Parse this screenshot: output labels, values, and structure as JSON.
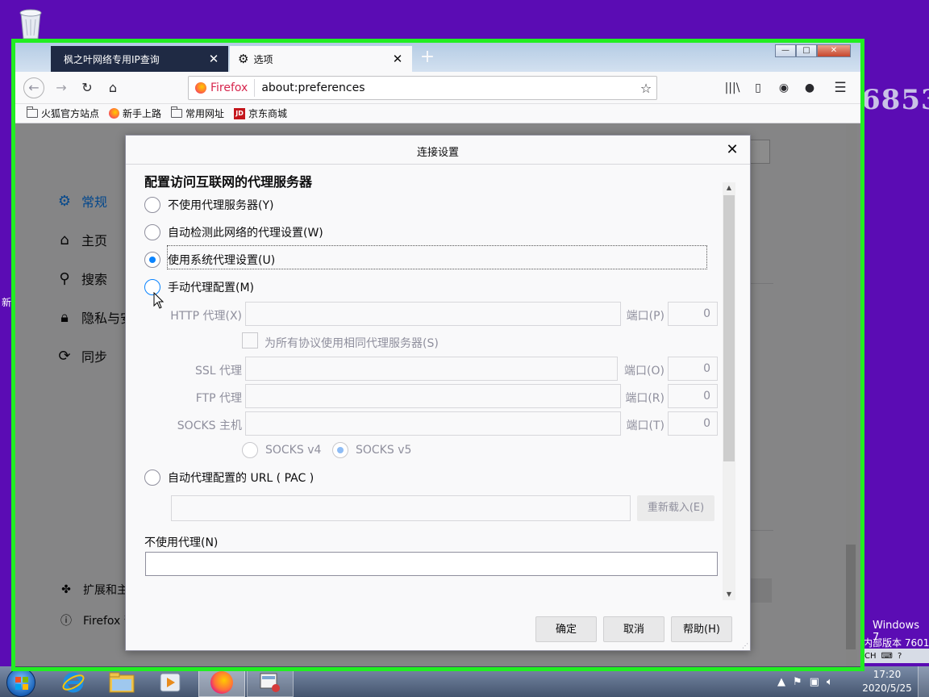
{
  "desktop": {
    "watermark": "6853",
    "side_text": "新",
    "windows_version": "Windows 7",
    "windows_build": "内部版本 7601"
  },
  "browser": {
    "tabs": [
      {
        "label": "枫之叶网络专用IP查询",
        "active": false
      },
      {
        "label": "选项",
        "active": true
      }
    ],
    "window_controls": {
      "minimize": "—",
      "maximize": "□",
      "close": "✕"
    },
    "url": {
      "identity": "Firefox",
      "text": "about:preferences"
    },
    "bookmarks": [
      {
        "label": "火狐官方站点",
        "icon": "folder-icon"
      },
      {
        "label": "新手上路",
        "icon": "firefox-icon"
      },
      {
        "label": "常用网址",
        "icon": "folder-icon"
      },
      {
        "label": "京东商城",
        "icon": "jd-icon"
      }
    ],
    "jd_icon_text": "JD"
  },
  "preferences": {
    "sidebar": [
      {
        "label": "常规",
        "icon": "gear-icon"
      },
      {
        "label": "主页",
        "icon": "home-icon"
      },
      {
        "label": "搜索",
        "icon": "search-icon"
      },
      {
        "label": "隐私与安",
        "icon": "lock-icon"
      },
      {
        "label": "同步",
        "icon": "sync-icon"
      }
    ],
    "extensions_label": "扩展和主",
    "help_label": "Firefox 帮"
  },
  "dialog": {
    "title": "连接设置",
    "heading": "配置访问互联网的代理服务器",
    "options": {
      "none": "不使用代理服务器(Y)",
      "auto_detect": "自动检测此网络的代理设置(W)",
      "system": "使用系统代理设置(U)",
      "manual": "手动代理配置(M)",
      "pac": "自动代理配置的 URL ( PAC )"
    },
    "selected": "system",
    "manual": {
      "http_label": "HTTP 代理(X)",
      "http_port_label": "端口(P)",
      "http_port": "0",
      "share_label": "为所有协议使用相同代理服务器(S)",
      "ssl_label": "SSL 代理",
      "ssl_port_label": "端口(O)",
      "ssl_port": "0",
      "ftp_label": "FTP 代理",
      "ftp_port_label": "端口(R)",
      "ftp_port": "0",
      "socks_label": "SOCKS 主机",
      "socks_port_label": "端口(T)",
      "socks_port": "0",
      "socks_v4": "SOCKS v4",
      "socks_v5": "SOCKS v5",
      "socks_version_selected": "SOCKS v5"
    },
    "reload_label": "重新载入(E)",
    "no_proxy_label": "不使用代理(N)",
    "buttons": {
      "ok": "确定",
      "cancel": "取消",
      "help": "帮助(H)"
    }
  },
  "taskbar": {
    "clock_time": "17:20",
    "clock_date": "2020/5/25",
    "language": "CH"
  },
  "colors": {
    "accent": "#0a84ff",
    "desktop": "#5b0cb4",
    "frame": "#22ee22"
  }
}
